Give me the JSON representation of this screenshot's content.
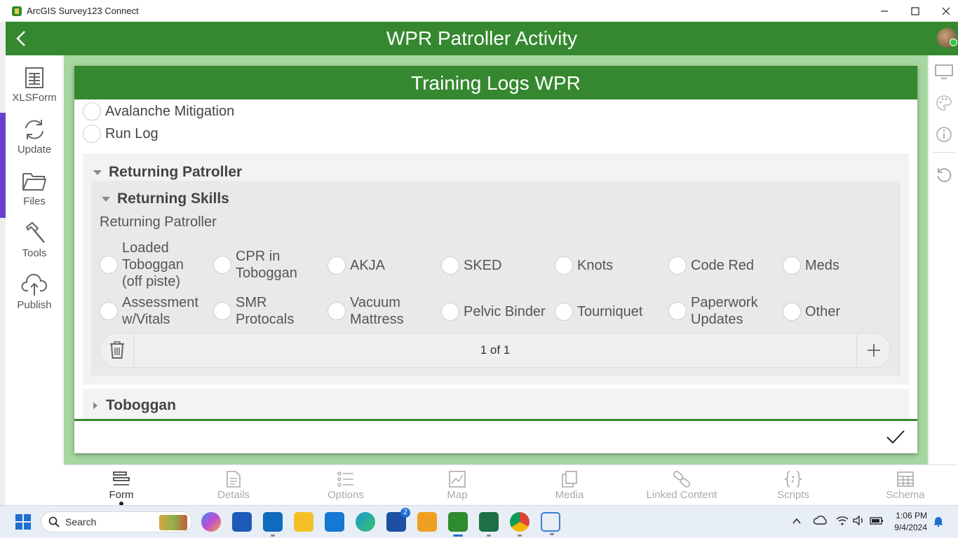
{
  "window": {
    "title": "ArcGIS Survey123 Connect",
    "controls": {
      "minimize": "—",
      "maximize": "☐",
      "close": "✕"
    }
  },
  "header": {
    "back_icon": "chevron-left-icon",
    "title": "WPR Patroller Activity"
  },
  "sidebar": {
    "items": [
      {
        "label": "XLSForm",
        "icon": "spreadsheet-icon"
      },
      {
        "label": "Update",
        "icon": "refresh-icon"
      },
      {
        "label": "Files",
        "icon": "folder-icon"
      },
      {
        "label": "Tools",
        "icon": "hammer-icon"
      },
      {
        "label": "Publish",
        "icon": "cloud-upload-icon"
      }
    ]
  },
  "form": {
    "title": "Training Logs WPR",
    "top_options": [
      "Avalanche Mitigation",
      "Run Log"
    ],
    "group": {
      "title": "Returning Patroller",
      "subgroup": {
        "title": "Returning Skills",
        "question_label": "Returning Patroller",
        "options_row1": [
          "Loaded Toboggan (off piste)",
          "CPR in Toboggan",
          "AKJA",
          "SKED",
          "Knots",
          "Code Red",
          "Meds"
        ],
        "options_row2": [
          "Assessment w/Vitals",
          "SMR Protocals",
          "Vacuum Mattress",
          "Pelvic Binder",
          "Tourniquet",
          "Paperwork Updates",
          "Other"
        ],
        "repeat_counter": "1 of 1"
      }
    },
    "collapsed_group": {
      "title": "Toboggan"
    }
  },
  "bottom_tabs": [
    {
      "label": "Form",
      "active": true
    },
    {
      "label": "Details",
      "active": false
    },
    {
      "label": "Options",
      "active": false
    },
    {
      "label": "Map",
      "active": false
    },
    {
      "label": "Media",
      "active": false
    },
    {
      "label": "Linked Content",
      "active": false
    },
    {
      "label": "Scripts",
      "active": false
    },
    {
      "label": "Schema",
      "active": false
    }
  ],
  "taskbar": {
    "search_label": "Search",
    "time": "1:06 PM",
    "date": "9/4/2024",
    "badge_count": "2"
  },
  "colors": {
    "brand_green": "#35882f",
    "form_background": "#a6d7a1"
  }
}
